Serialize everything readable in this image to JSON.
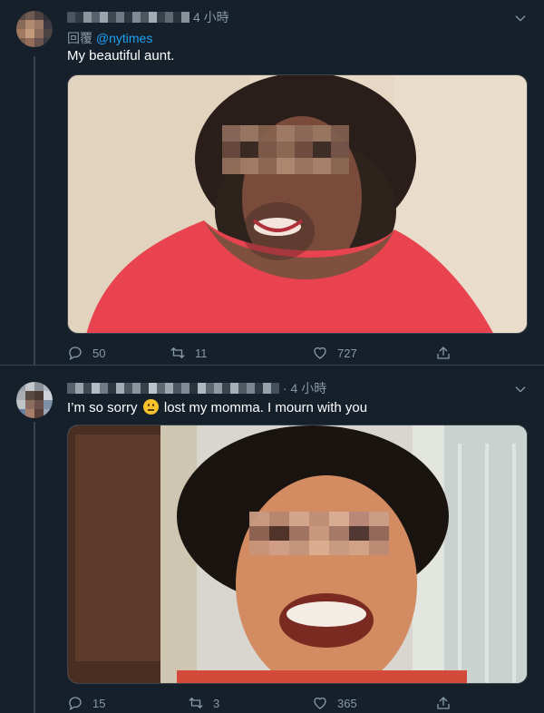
{
  "tweets": [
    {
      "time": "4 小時",
      "reply_prefix": "回覆",
      "reply_to": "@nytimes",
      "text": "My beautiful aunt.",
      "stats": {
        "replies": "50",
        "retweets": "11",
        "likes": "727"
      }
    },
    {
      "time": "· 4 小時",
      "text_before": "I’m so sorry",
      "text_after": "lost my momma. I mourn with you",
      "stats": {
        "replies": "15",
        "retweets": "3",
        "likes": "365"
      }
    }
  ],
  "icons": [
    "chevron-down-icon",
    "reply-icon",
    "retweet-icon",
    "like-icon",
    "share-icon",
    "pensive-face-emoji"
  ],
  "colors": {
    "background": "#15202b",
    "secondary_text": "#8899a6",
    "link": "#1da1f2",
    "divider": "#38444d"
  }
}
